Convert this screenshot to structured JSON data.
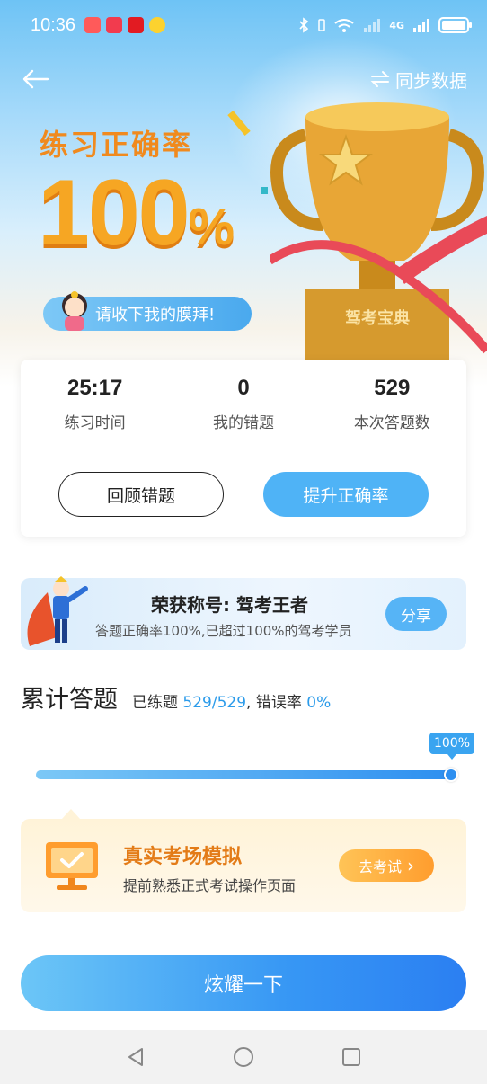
{
  "status_bar": {
    "time": "10:36",
    "network": "4G",
    "apps": [
      "app-icon-red",
      "app-icon-red-square",
      "app-icon-news",
      "app-icon-yellow"
    ]
  },
  "nav": {
    "sync_label": "同步数据"
  },
  "hero": {
    "label": "练习正确率",
    "value": "100",
    "unit": "%",
    "pill_text": "请收下我的膜拜!",
    "trophy_text": "驾考宝典"
  },
  "stats": {
    "items": [
      {
        "value": "25:17",
        "label": "练习时间"
      },
      {
        "value": "0",
        "label": "我的错题"
      },
      {
        "value": "529",
        "label": "本次答题数"
      }
    ],
    "review_button": "回顾错题",
    "improve_button": "提升正确率"
  },
  "title_banner": {
    "title": "荣获称号: 驾考王者",
    "subtitle": "答题正确率100%,已超过100%的驾考学员",
    "share_button": "分享"
  },
  "progress": {
    "title": "累计答题",
    "done_label": "已练题",
    "done_value": "529/529",
    "separator": ",",
    "error_label": "错误率",
    "error_value": "0%",
    "badge": "100%",
    "fraction": 1.0
  },
  "exam": {
    "title": "真实考场模拟",
    "subtitle": "提前熟悉正式考试操作页面",
    "button": "去考试",
    "button_arrow": "›"
  },
  "cta": {
    "label": "炫耀一下"
  },
  "colors": {
    "accent_blue": "#4fb3f6",
    "accent_orange": "#f6a623",
    "exam_orange": "#e37b17"
  }
}
